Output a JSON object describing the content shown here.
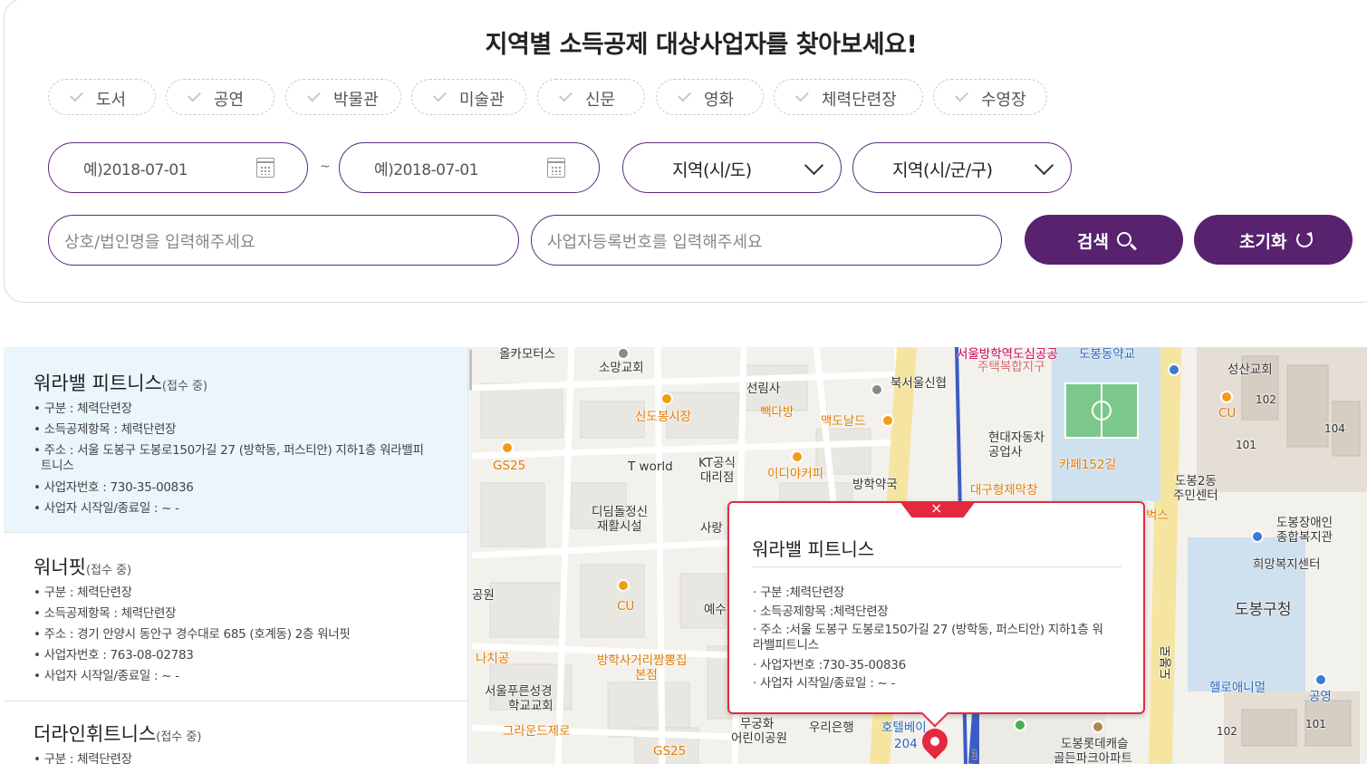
{
  "title": "지역별 소득공제 대상사업자를 찾아보세요!",
  "categories": [
    "도서",
    "공연",
    "박물관",
    "미술관",
    "신문",
    "영화",
    "체력단련장",
    "수영장"
  ],
  "date_from": "예)2018-07-01",
  "date_sep": "~",
  "date_to": "예)2018-07-01",
  "region_select": "지역(시/도)",
  "district_select": "지역(시/군/구)",
  "name_placeholder": "상호/법인명을 입력해주세요",
  "bizno_placeholder": "사업자등록번호를 입력해주세요",
  "search_button": "검색",
  "reset_button": "초기화",
  "icons": [
    "check-icon",
    "calendar-icon",
    "chevron-down-icon",
    "search-icon",
    "refresh-icon",
    "close-icon",
    "map-pin-icon"
  ],
  "colors": {
    "brand": "#58226f",
    "accent": "#e5293f",
    "selected_row": "#eaf5fc"
  },
  "results": [
    {
      "name": "워라밸 피트니스",
      "status": "(접수 중)",
      "lines": [
        "• 구분 : 체력단련장",
        "• 소득공제항목 : 체력단련장",
        "• 주소 : 서울 도봉구 도봉로150가길 27 (방학동, 퍼스티안) 지하1층 워라밸피",
        "트니스",
        "• 사업자번호 : 730-35-00836",
        "• 사업자 시작일/종료일 :  ~ -"
      ]
    },
    {
      "name": "워너핏",
      "status": "(접수 중)",
      "lines": [
        "• 구분 : 체력단련장",
        "• 소득공제항목 : 체력단련장",
        "• 주소 : 경기 안양시 동안구 경수대로 685 (호계동) 2층 워너핏",
        "• 사업자번호 : 763-08-02783",
        "• 사업자 시작일/종료일 :  ~ -"
      ]
    },
    {
      "name": "더라인휘트니스",
      "status": "(접수 중)",
      "lines": [
        "• 구분 : 체력단련장"
      ]
    }
  ],
  "popup": {
    "close": "×",
    "title": "워라밸 피트니스",
    "lines": [
      "· 구분 :체력단련장",
      "· 소득공제항목 :체력단련장",
      "· 주소 :서울 도봉구 도봉로150가길 27 (방학동, 퍼스티안) 지하1층 워",
      "  라밸피트니스",
      "· 사업자번호 :730-35-00836",
      "· 사업자 시작일/종료일 : ~ -"
    ]
  },
  "map_labels": {
    "l1": "올카모터스",
    "l2": "소망교회",
    "l3": "선림사",
    "l4": "서울방학역도심공공",
    "l5": "주택복합지구",
    "l6": "도봉동약교",
    "l7": "성산교회",
    "l8": "102",
    "l9": "CU",
    "l10": "104",
    "l11": "101",
    "l12": "북서울신협",
    "l13": "신도봉시장",
    "l14": "빽다방",
    "l15": "맥도날드",
    "l16": "현대자동차",
    "l17": "공업사",
    "l18": "GS25",
    "l19": "T world",
    "l20": "KT공식",
    "l21": "대리점",
    "l22": "이디야커피",
    "l23": "방학약국",
    "l24": "카페152길",
    "l25": "도봉2동",
    "l26": "주민센터",
    "l27": "대구형제막창",
    "l28": "디딤돌정신",
    "l29": "재활시설",
    "l30": "사랑",
    "l31": "벅스",
    "l32": "도봉장애인",
    "l33": "종합복지관",
    "l34": "희망복지센터",
    "l35": "도봉구청",
    "l36": "공원",
    "l37": "CU",
    "l38": "예수",
    "l39": "나치공",
    "l40": "방학사거리짬뽕집",
    "l41": "본점",
    "l42": "도봉로",
    "l43": "헬로애니멀",
    "l44": "공영",
    "l45": "서울푸른성경",
    "l46": "학교교회",
    "l47": "그라운드제로",
    "l48": "GS25",
    "l49": "무궁화",
    "l50": "어린이공원",
    "l51": "우리은행",
    "l52": "호텔베이",
    "l53": "204",
    "l54": "도봉롯데캐슬",
    "l55": "골든파크아파트",
    "l56": "102",
    "l57": "101",
    "l58": "1"
  }
}
